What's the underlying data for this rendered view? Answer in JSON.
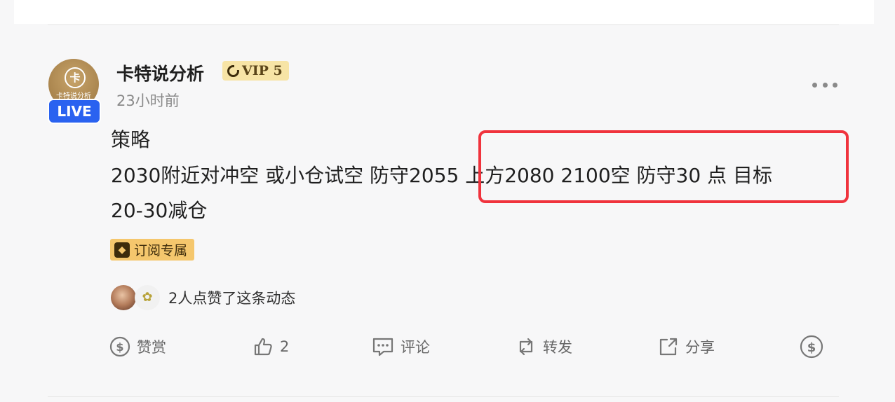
{
  "post": {
    "author": "卡特说分析",
    "avatar_text": "卡特说分析",
    "live_label": "LIVE",
    "vip_label": "VIP 5",
    "time": "23小时前",
    "title": "策略",
    "body": "2030附近对冲空 或小仓试空 防守2055  上方2080  2100空 防守30 点 目标\n20-30减仓",
    "tag": "订阅专属"
  },
  "likes": {
    "text": "2人点赞了这条动态"
  },
  "actions": {
    "reward": "赞赏",
    "like_count": "2",
    "comment": "评论",
    "repost": "转发",
    "share": "分享"
  },
  "colors": {
    "highlight": "#f0333d",
    "live_badge": "#2a62f0",
    "vip_bg": "#f7e4a6",
    "tag_bg": "#f5c76d"
  }
}
